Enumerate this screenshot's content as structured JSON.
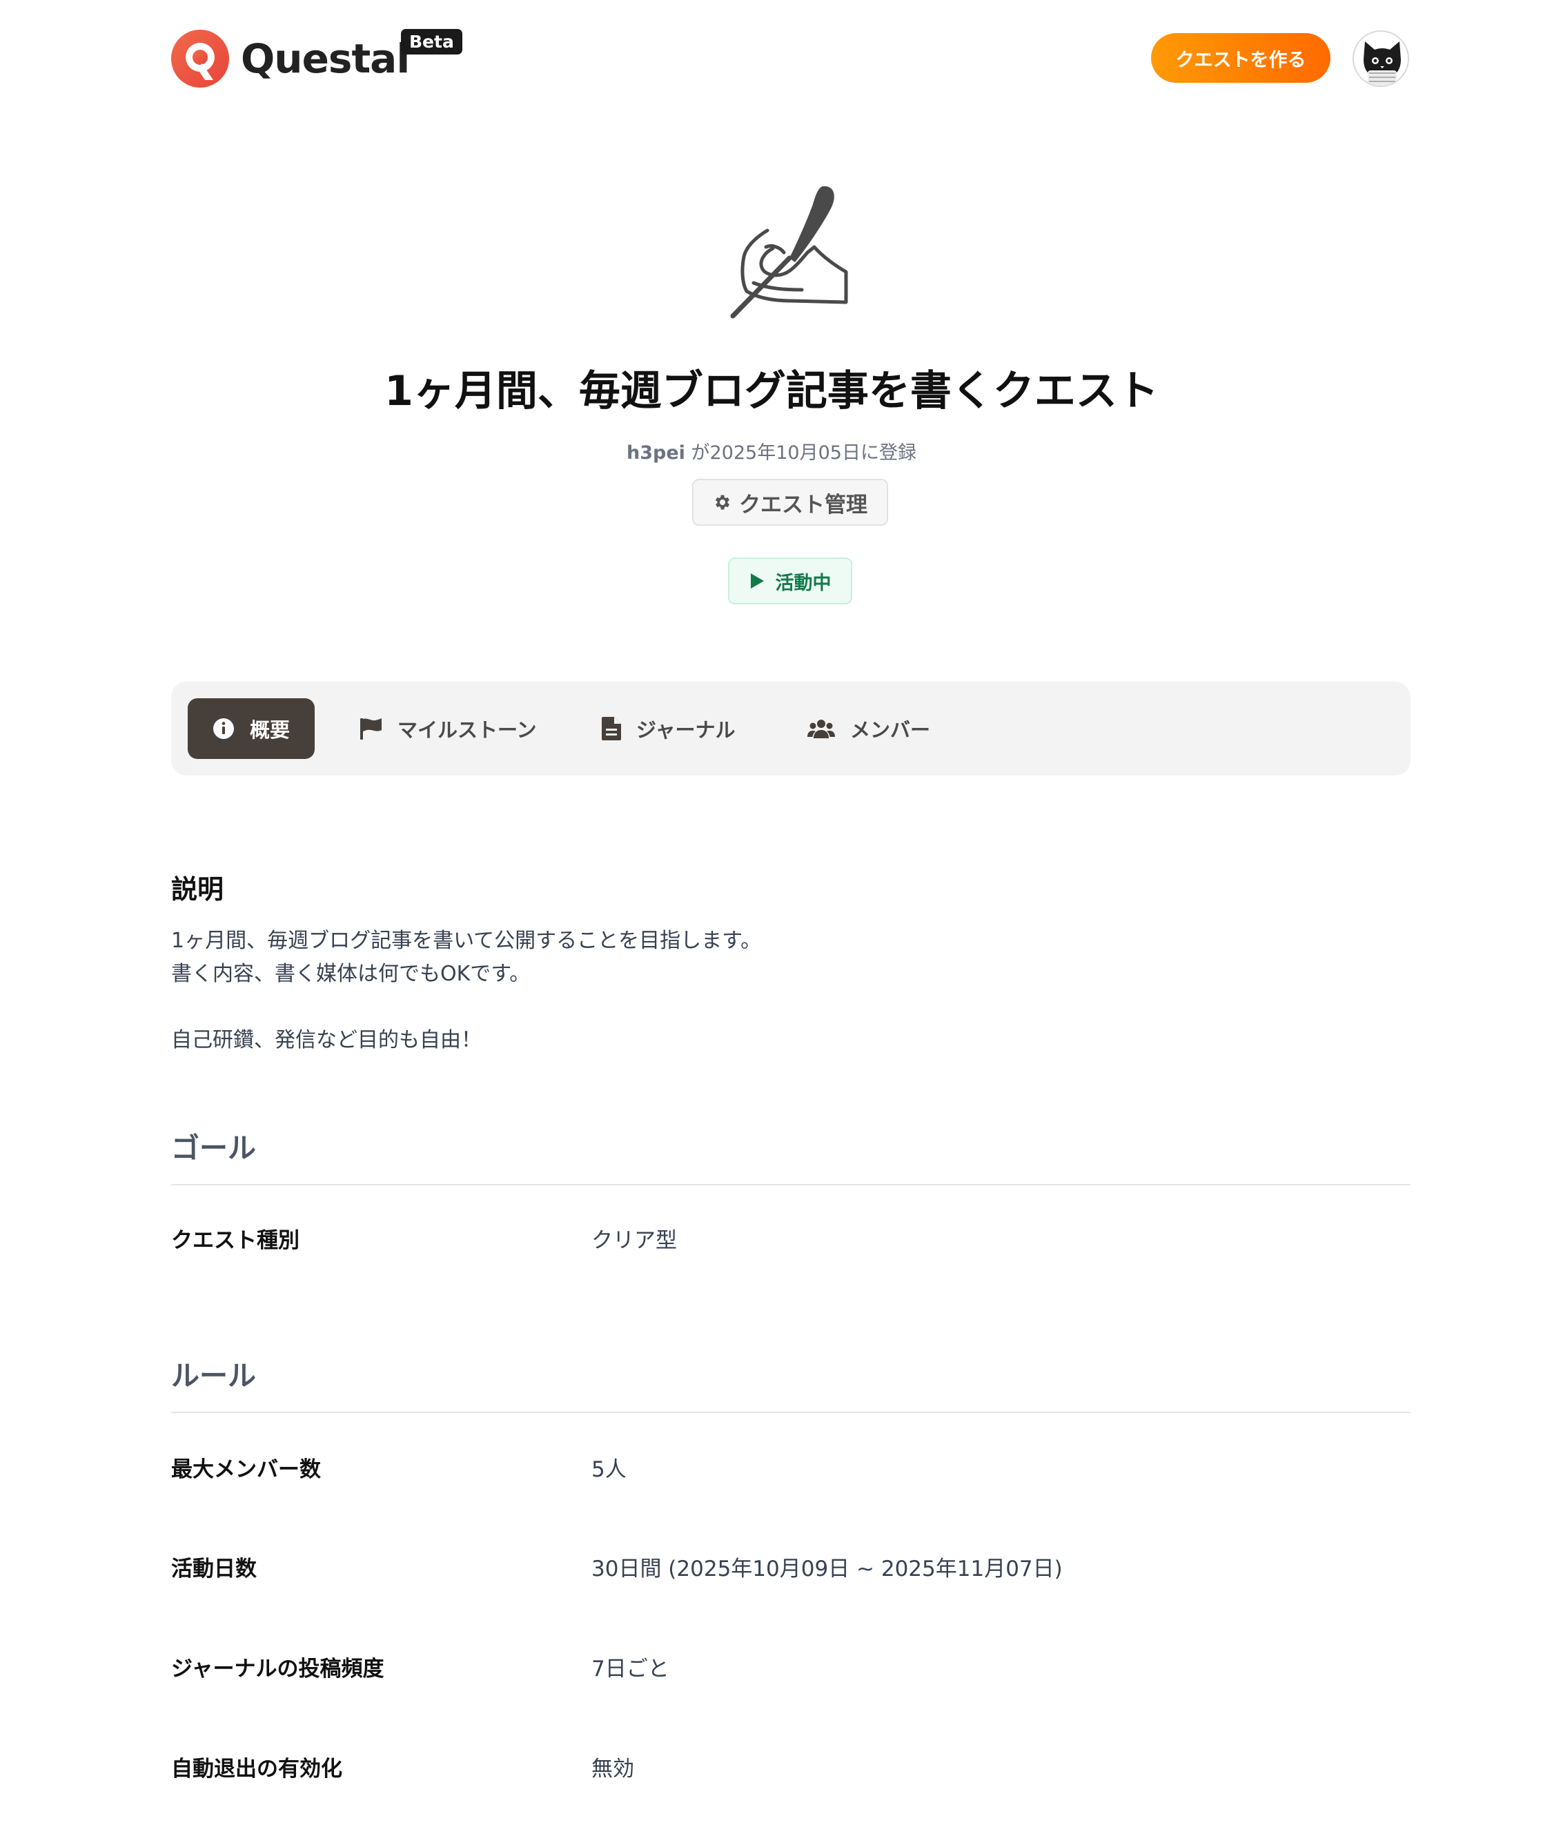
{
  "header": {
    "logo_text": "Questal",
    "beta_label": "Beta",
    "create_button": "クエストを作る"
  },
  "quest": {
    "title": "1ヶ月間、毎週ブログ記事を書くクエスト",
    "author": "h3pei",
    "registered_text": " が2025年10月05日に登録",
    "manage_button": "クエスト管理",
    "status": "活動中"
  },
  "tabs": [
    {
      "label": "概要",
      "icon": "info-icon",
      "active": true
    },
    {
      "label": "マイルストーン",
      "icon": "flag-icon",
      "active": false
    },
    {
      "label": "ジャーナル",
      "icon": "document-icon",
      "active": false
    },
    {
      "label": "メンバー",
      "icon": "users-icon",
      "active": false
    }
  ],
  "description": {
    "heading": "説明",
    "lines": [
      "1ヶ月間、毎週ブログ記事を書いて公開することを目指します。",
      "書く内容、書く媒体は何でもOKです。",
      "",
      "自己研鑽、発信など目的も自由！"
    ]
  },
  "goal": {
    "heading": "ゴール",
    "rows": [
      {
        "label": "クエスト種別",
        "value": "クリア型"
      }
    ]
  },
  "rules": {
    "heading": "ルール",
    "rows": [
      {
        "label": "最大メンバー数",
        "value": "5人"
      },
      {
        "label": "活動日数",
        "value": "30日間 (2025年10月09日 ~ 2025年11月07日)"
      },
      {
        "label": "ジャーナルの投稿頻度",
        "value": "7日ごと"
      },
      {
        "label": "自動退出の有効化",
        "value": "無効"
      }
    ]
  },
  "colors": {
    "accent_orange": "#ff7a00",
    "tab_active_bg": "#463f3a",
    "status_green": "#137a4a"
  }
}
